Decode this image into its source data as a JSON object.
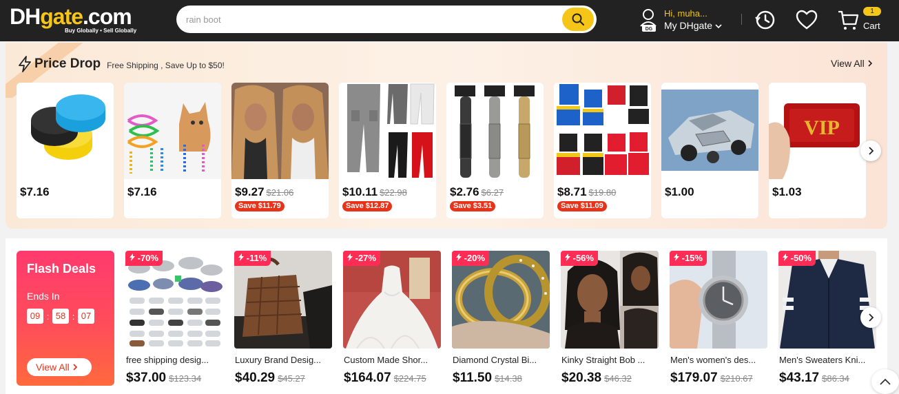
{
  "header": {
    "logo_text_a": "DH",
    "logo_text_b": "gate",
    "logo_text_c": ".com",
    "logo_tagline": "Buy Globally • Sell Globally",
    "search_placeholder": "rain boot",
    "user_greeting": "Hi, muha...",
    "user_account": "My DHgate",
    "cart_count": "1",
    "cart_label": "Cart"
  },
  "price_drop": {
    "title": "Price Drop",
    "subtitle": "Free Shipping ,  Save Up to $50!",
    "view_all": "View All",
    "items": [
      {
        "price": "$7.16",
        "original": "",
        "save": "",
        "image": "sponge-pads"
      },
      {
        "price": "$7.16",
        "original": "",
        "save": "",
        "image": "cat-spring-toys"
      },
      {
        "price": "$9.27",
        "original": "$21.06",
        "save": "Save $11.79",
        "image": "wig"
      },
      {
        "price": "$10.11",
        "original": "$22.98",
        "save": "Save $12.87",
        "image": "cargo-pants"
      },
      {
        "price": "$2.76",
        "original": "$6.27",
        "save": "Save $3.51",
        "image": "hair-trimmers"
      },
      {
        "price": "$8.71",
        "original": "$19.80",
        "save": "Save $11.09",
        "image": "boxing-uniforms"
      },
      {
        "price": "$1.00",
        "original": "",
        "save": "",
        "image": "model-car"
      },
      {
        "price": "$1.03",
        "original": "",
        "save": "",
        "image": "vip-card"
      }
    ]
  },
  "flash_deals": {
    "title": "Flash Deals",
    "ends_in": "Ends In",
    "timer": {
      "hours": "09",
      "minutes": "58",
      "seconds": "07"
    },
    "view_all": "View All",
    "items": [
      {
        "discount": "-70%",
        "name": "free shipping desig...",
        "price": "$37.00",
        "original": "$123.34",
        "image": "sneakers-grid"
      },
      {
        "discount": "-11%",
        "name": "Luxury Brand Desig...",
        "price": "$40.29",
        "original": "$45.27",
        "image": "woven-bag"
      },
      {
        "discount": "-27%",
        "name": "Custom Made Shor...",
        "price": "$164.07",
        "original": "$224.75",
        "image": "wedding-dress"
      },
      {
        "discount": "-20%",
        "name": "Diamond Crystal Bi...",
        "price": "$11.50",
        "original": "$14.38",
        "image": "gold-bracelet"
      },
      {
        "discount": "-56%",
        "name": "Kinky Straight Bob ...",
        "price": "$20.38",
        "original": "$46.32",
        "image": "bob-wig"
      },
      {
        "discount": "-15%",
        "name": "Men's women's des...",
        "price": "$179.07",
        "original": "$210.67",
        "image": "wristwatch"
      },
      {
        "discount": "-50%",
        "name": "Men's Sweaters Kni...",
        "price": "$43.17",
        "original": "$86.34",
        "image": "varsity-jacket"
      }
    ]
  },
  "colors": {
    "header_bg": "#222222",
    "brand_yellow": "#f5c518",
    "save_red": "#e8331b",
    "flash_pink": "#ff2d55"
  }
}
